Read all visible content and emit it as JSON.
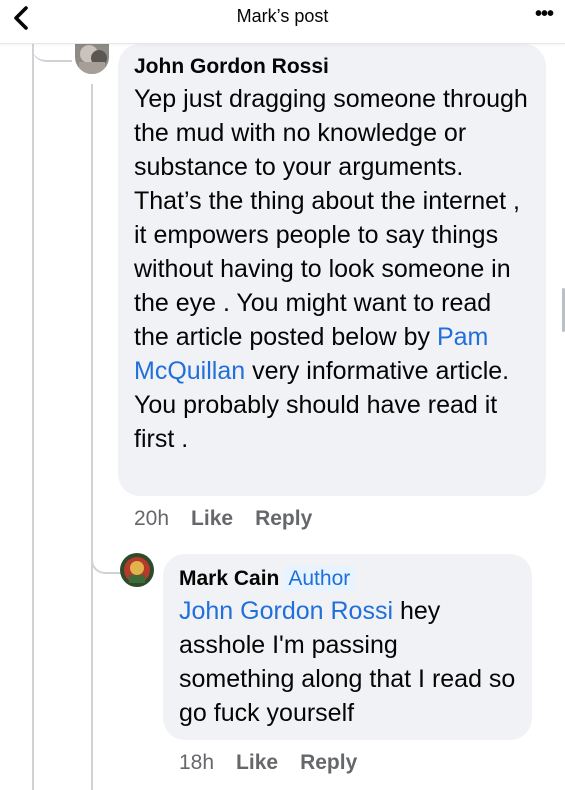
{
  "header": {
    "title": "Mark’s post",
    "back_icon": "chevron-left-icon",
    "more_icon": "more-dots-icon"
  },
  "comments": [
    {
      "author": "John Gordon Rossi",
      "text_before_mention": "Yep just dragging someone through the mud with no knowledge or substance to your arguments. That’s the thing about the internet , it empowers people to say things without having to look someone in the eye . You might want to read the article posted below by ",
      "mention": "Pam McQuillan",
      "text_after_mention": " very informative article. You probably should have read it first .",
      "time": "20h",
      "like_label": "Like",
      "reply_label": "Reply"
    },
    {
      "author": "Mark Cain",
      "badge": "Author",
      "mention": "John Gordon Rossi",
      "text_after_mention": " hey asshole I'm passing something along that I read so go fuck yourself",
      "time": "18h",
      "like_label": "Like",
      "reply_label": "Reply"
    }
  ],
  "colors": {
    "link": "#216fdb",
    "bubble": "#f0f2f5",
    "meta": "#65676b",
    "badge_bg": "#e7f3ff"
  }
}
